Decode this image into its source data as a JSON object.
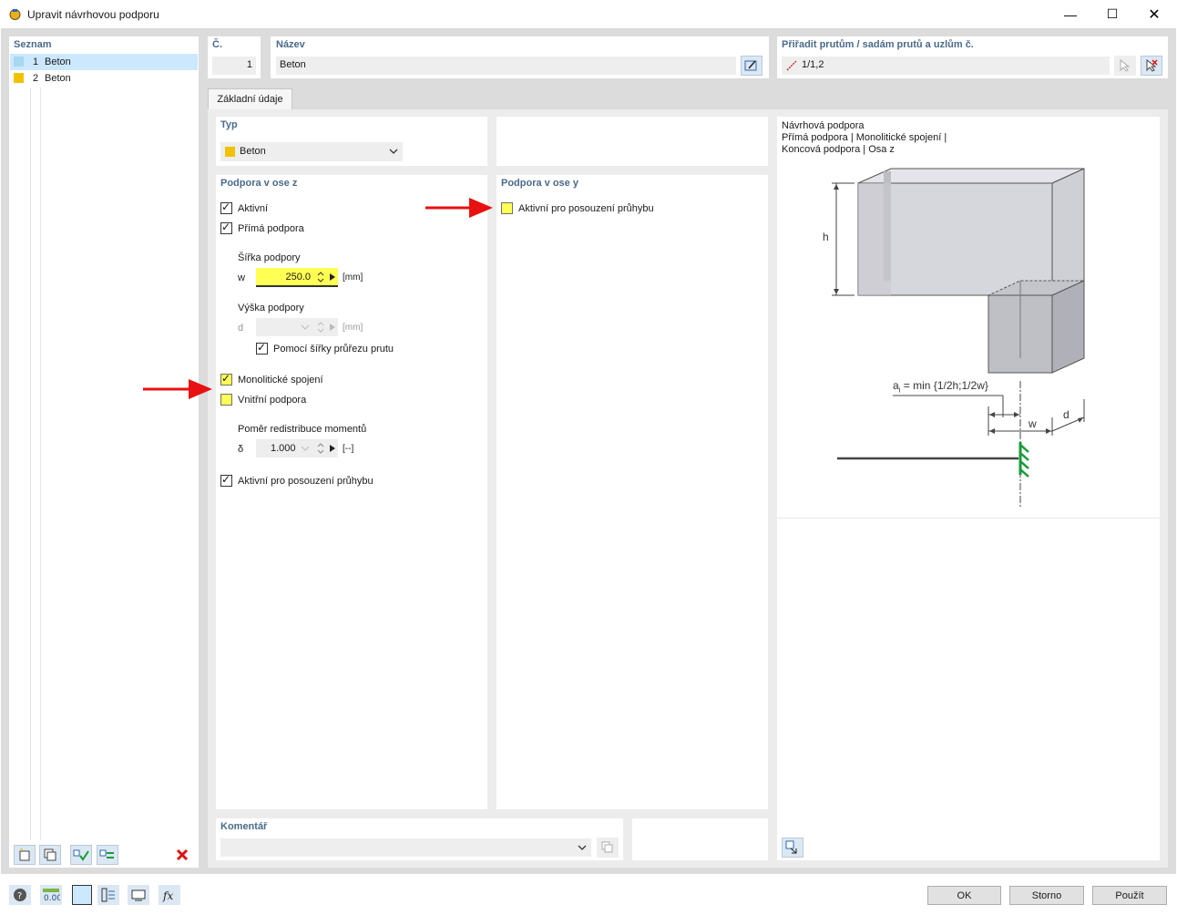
{
  "window": {
    "title": "Upravit návrhovou podporu"
  },
  "list": {
    "header": "Seznam",
    "items": [
      {
        "num": "1",
        "label": "Beton",
        "color": "#a6d8f0"
      },
      {
        "num": "2",
        "label": "Beton",
        "color": "#f2c200"
      }
    ]
  },
  "header_fields": {
    "no_label": "Č.",
    "no_value": "1",
    "name_label": "Název",
    "name_value": "Beton",
    "assign_label": "Přiřadit prutům / sadám prutů a uzlům č.",
    "assign_value": "1/1,2"
  },
  "tabs": [
    {
      "label": "Základní údaje"
    }
  ],
  "type_section": {
    "header": "Typ",
    "selected": "Beton",
    "selected_color": "#f2c200"
  },
  "z_section": {
    "header": "Podpora v ose z",
    "active_label": "Aktivní",
    "direct_label": "Přímá podpora",
    "width_header": "Šířka podpory",
    "width_symbol": "w",
    "width_value": "250.0",
    "width_unit": "[mm]",
    "height_header": "Výška podpory",
    "height_symbol": "d",
    "height_value": "",
    "height_unit": "[mm]",
    "by_width_label": "Pomocí šířky průřezu prutu",
    "monolithic_label": "Monolitické spojení",
    "internal_label": "Vnitřní podpora",
    "redistribution_header": "Poměr redistribuce momentů",
    "delta_symbol": "δ",
    "delta_value": "1.000",
    "delta_unit": "[--]",
    "deflection_label": "Aktivní pro posouzení průhybu"
  },
  "y_section": {
    "header": "Podpora v ose y",
    "deflection_label": "Aktivní pro posouzení průhybu"
  },
  "preview": {
    "line1": "Návrhová podpora",
    "line2": "Přímá podpora | Monolitické spojení |",
    "line3": "Koncová podpora | Osa z",
    "label_h": "h",
    "label_a": "a",
    "label_a_sub": "i",
    "label_formula": " = min {1/2h;1/2w}",
    "label_w": "w",
    "label_d": "d"
  },
  "comment": {
    "header": "Komentář",
    "value": ""
  },
  "buttons": {
    "ok": "OK",
    "cancel": "Storno",
    "apply": "Použít"
  },
  "colors": {
    "accent_arrow": "#e81010",
    "support_green": "#1a9a3a",
    "selection": "#cce8ff",
    "header_text": "#4a6a8a"
  }
}
